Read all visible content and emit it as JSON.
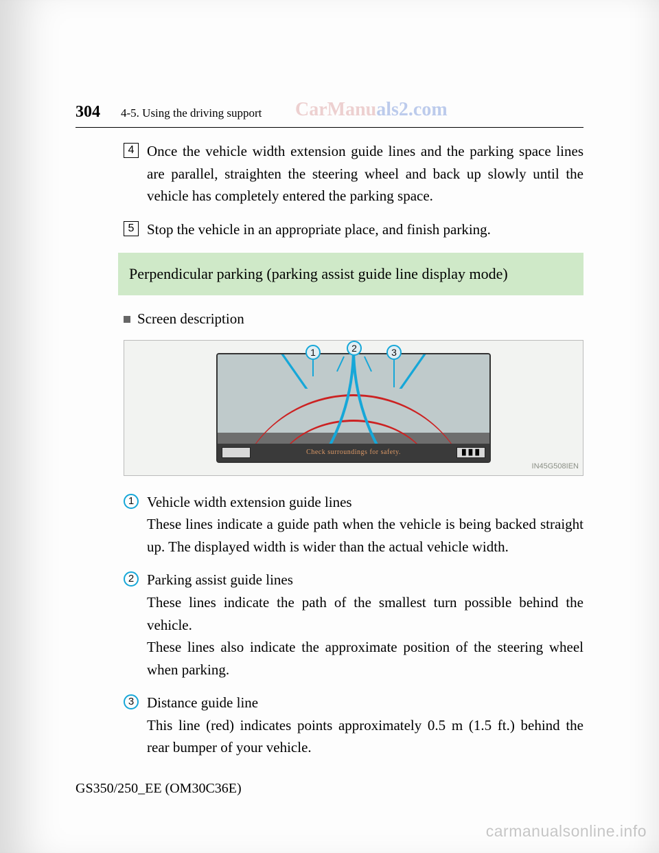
{
  "header": {
    "page_number": "304",
    "section_path": "4-5. Using the driving support",
    "watermark_top_a": "CarManu",
    "watermark_top_b": "als2.com"
  },
  "steps": {
    "four": {
      "num": "4",
      "text": "Once the vehicle width extension guide lines and the parking space lines are parallel, straighten the steering wheel and back up slowly until the vehicle has completely entered the parking space."
    },
    "five": {
      "num": "5",
      "text": "Stop the vehicle in an appropriate place, and finish parking."
    }
  },
  "green_heading": "Perpendicular parking (parking assist guide line display mode)",
  "bullet_label": "Screen description",
  "figure": {
    "code": "IN45G508IEN",
    "callouts": {
      "one": "1",
      "two": "2",
      "three": "3"
    },
    "bottom_warning": "Check surroundings for safety.",
    "btn_right_label": "█ █ █"
  },
  "items": {
    "one": {
      "num": "1",
      "title": "Vehicle width extension guide lines",
      "desc": "These lines indicate a guide path when the vehicle is being backed straight up. The displayed width is wider than the actual vehicle width."
    },
    "two": {
      "num": "2",
      "title": "Parking assist guide lines",
      "desc1": "These lines indicate the path of the smallest turn possible behind the vehicle.",
      "desc2": "These lines also indicate the approximate position of the steering wheel when parking."
    },
    "three": {
      "num": "3",
      "title": "Distance guide line",
      "desc": "This line (red) indicates points approximately 0.5 m (1.5 ft.) behind the rear bumper of your vehicle."
    }
  },
  "footer_code": "GS350/250_EE (OM30C36E)",
  "watermark_bottom": "carmanualsonline.info"
}
